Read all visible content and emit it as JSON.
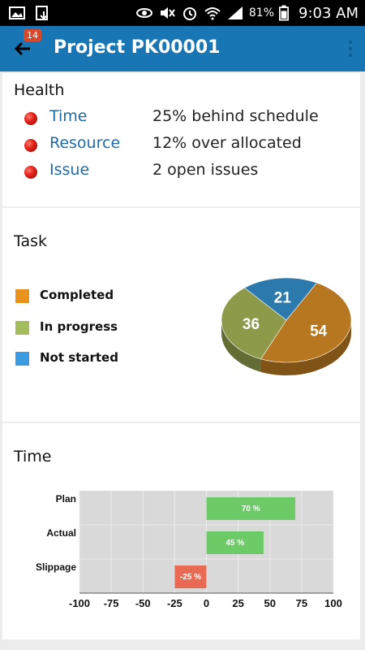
{
  "status_bar": {
    "battery": "81%",
    "time": "9:03 AM",
    "left_icons": [
      "image-icon",
      "download-icon"
    ],
    "right_icons": [
      "eye-icon",
      "mute-icon",
      "alarm-icon",
      "wifi-icon",
      "signal-icon",
      "battery-icon"
    ]
  },
  "app_bar": {
    "title": "Project PK00001",
    "badge": "14",
    "color": "#1976b5"
  },
  "health": {
    "title": "Health",
    "items": [
      {
        "label": "Time",
        "value": "25% behind schedule",
        "status_color": "#e3231a"
      },
      {
        "label": "Resource",
        "value": "12% over allocated",
        "status_color": "#e3231a"
      },
      {
        "label": "Issue",
        "value": "2 open issues",
        "status_color": "#e3231a"
      }
    ]
  },
  "task": {
    "title": "Task",
    "legend": [
      {
        "label": "Completed",
        "color": "#e8931e"
      },
      {
        "label": "In progress",
        "color": "#a3bc5c"
      },
      {
        "label": "Not started",
        "color": "#3b9be0"
      }
    ]
  },
  "time": {
    "title": "Time"
  },
  "chart_data": [
    {
      "type": "pie",
      "categories": [
        "Completed",
        "In progress",
        "Not started"
      ],
      "values": [
        54,
        36,
        21
      ],
      "colors": [
        "#b77620",
        "#8c9a4a",
        "#2c79ad"
      ],
      "labels": [
        "54",
        "36",
        "21"
      ]
    },
    {
      "type": "bar",
      "orientation": "horizontal",
      "categories": [
        "Plan",
        "Actual",
        "Slippage"
      ],
      "values": [
        70,
        45,
        -25
      ],
      "value_labels": [
        "70 %",
        "45 %",
        "-25 %"
      ],
      "colors": [
        "#6dcb67",
        "#6dcb67",
        "#e86a52"
      ],
      "xlim": [
        -100,
        100
      ],
      "xticks": [
        -100,
        -75,
        -50,
        -25,
        0,
        25,
        50,
        75,
        100
      ],
      "grid": true
    }
  ]
}
